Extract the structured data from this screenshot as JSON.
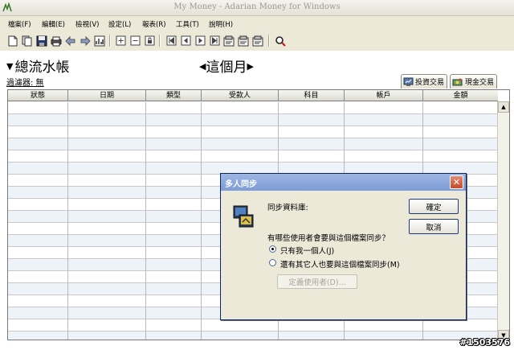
{
  "window": {
    "title": "My Money - Adarian Money for Windows"
  },
  "menu": [
    "檔案(F)",
    "編輯(E)",
    "檢視(V)",
    "設定(L)",
    "報表(R)",
    "工具(T)",
    "說明(H)"
  ],
  "register": {
    "title": "總流水帳",
    "period": "這個月",
    "filter": "過濾器: 無",
    "tabs": {
      "investment": "投資交易",
      "cash": "現金交易"
    },
    "columns": [
      "狀態",
      "日期",
      "類型",
      "受款人",
      "科目",
      "帳戶",
      "金額"
    ]
  },
  "dialog": {
    "title": "多人同步",
    "database_label": "同步資料庫:",
    "question": "有哪些使用者會要與這個檔案同步？",
    "option_only_me": "只有我一個人(J)",
    "option_others": "還有其它人也要與這個檔案同步(M)",
    "option_selected": "only_me",
    "ok": "確定",
    "cancel": "取消",
    "define_users": "定義使用者(D)..."
  },
  "watermark": "#1503576"
}
